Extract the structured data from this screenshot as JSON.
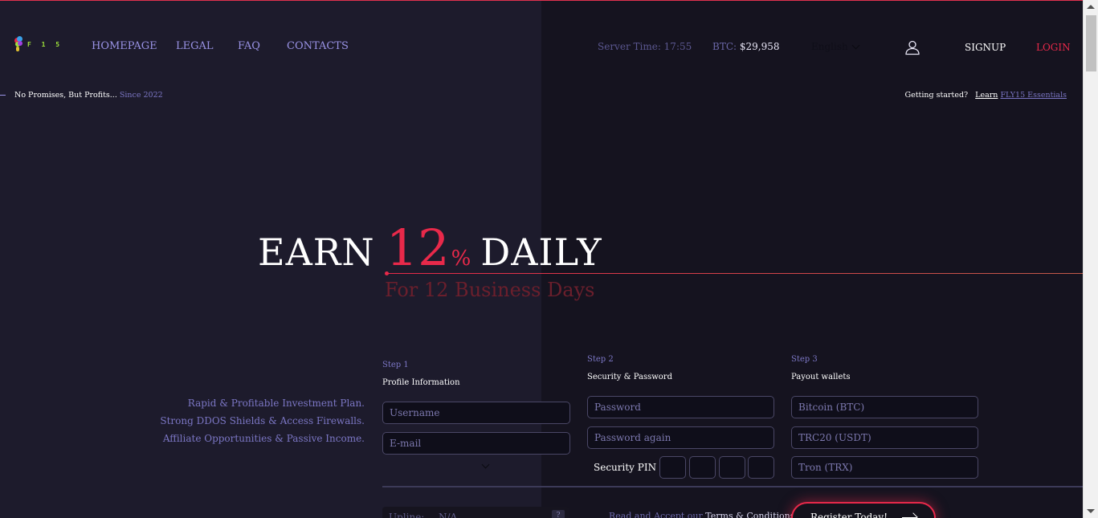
{
  "header": {
    "logo_text": "F 1 5",
    "nav": [
      "HOMEPAGE",
      "LEGAL",
      "FAQ",
      "CONTACTS"
    ],
    "server_time": "Server Time: 17:55",
    "btc_label": "BTC:",
    "btc_value": "$29,958",
    "language": "English",
    "signup": "SIGNUP",
    "login": "LOGIN"
  },
  "subheader": {
    "tagline": "No Promises, But Profits...",
    "since": "Since 2022",
    "getting_started": "Getting started?",
    "learn": "Learn",
    "essentials": "FLY15 Essentials"
  },
  "hero": {
    "earn": "EARN",
    "rate": "12",
    "percent": "%",
    "daily": "DAILY",
    "subtitle": "For 12 Business Days"
  },
  "features": [
    "Rapid & Profitable Investment Plan.",
    "Strong DDOS Shields & Access Firewalls.",
    "Affiliate Opportunities & Passive Income."
  ],
  "steps": [
    {
      "label": "Step 1",
      "title": "Profile Information",
      "placeholders": [
        "Username",
        "E-mail"
      ]
    },
    {
      "label": "Step 2",
      "title": "Security & Password",
      "placeholders": [
        "Password",
        "Password again"
      ],
      "pin_label": "Security PIN"
    },
    {
      "label": "Step 3",
      "title": "Payout wallets",
      "placeholders": [
        "Bitcoin (BTC)",
        "TRC20 (USDT)",
        "Tron (TRX)"
      ]
    }
  ],
  "upline": {
    "label": "Upline:",
    "value": "N/A",
    "help": "?"
  },
  "terms": {
    "prefix": "Read and Accept our",
    "link": "Terms & Conditions"
  },
  "register_label": "Register Today!",
  "colors": {
    "accent": "#e8294a",
    "nav": "#9a93e6",
    "background_left": "#1d1b2c",
    "background_right": "#15131f"
  }
}
